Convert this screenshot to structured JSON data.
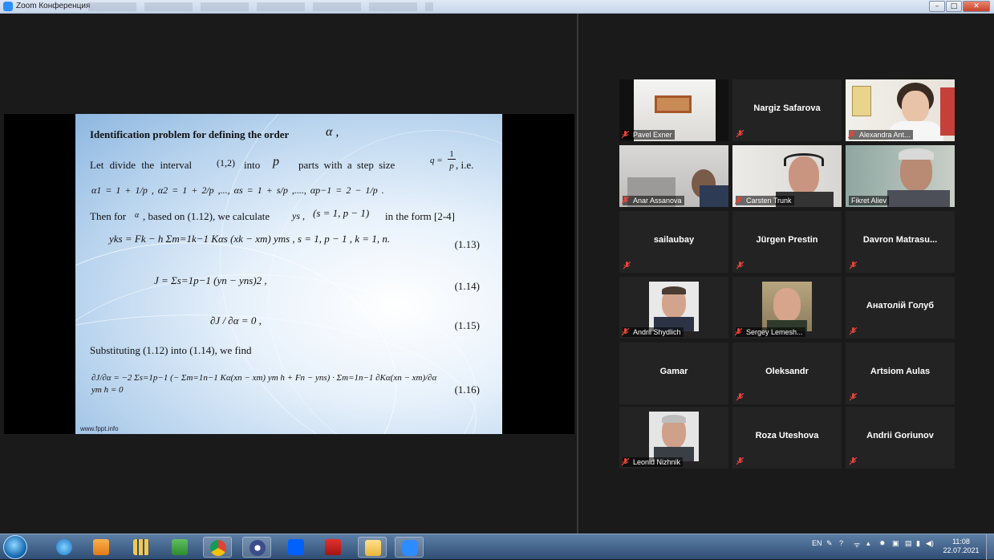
{
  "window": {
    "title": "Zoom Конференция"
  },
  "slide": {
    "heading": "Identification problem for defining the order",
    "heading_symbol": "α ,",
    "line1_prefix": "Let divide the interval",
    "interval": "(1,2)",
    "line1_mid": "into",
    "p": "p",
    "line1_suffix": "parts with a step size",
    "q_eq": "q =",
    "q_num": "1",
    "q_den": "p",
    "ie": ", i.e.",
    "alpha_line": "α1 = 1 + 1/p , α2 = 1 + 2/p ,..., αs = 1 + s/p ,...., αp−1 = 2 − 1/p .",
    "then_prefix": "Then for",
    "then_alpha": "α",
    "then_mid": ", based on (1.12), we calculate",
    "then_y": "ys ,",
    "then_range": "(s = 1, p − 1)",
    "then_suffix": "in the form  [2-4]",
    "eq113": "yks = Fk − h Σm=1k−1 Kαs (xk − xm) yms ,   s = 1, p − 1 ,   k = 1, n.",
    "eq113_no": "(1.13)",
    "eq114": "J = Σs=1p−1 (yn − yns)2 ,",
    "eq114_no": "(1.14)",
    "eq115": "∂J / ∂α = 0 ,",
    "eq115_no": "(1.15)",
    "subst": "Substituting (1.12) into (1.14), we find",
    "eq116": "∂J/∂α = −2 Σs=1p−1 (− Σm=1n−1 Kα(xn − xm) ym h + Fn − yns) · Σm=1n−1 ∂Kα(xn − xm)/∂α ym h = 0",
    "eq116_no": "(1.16)",
    "footer": "www.fppt.info"
  },
  "participants": [
    {
      "name": "Pavel Exner",
      "video": true,
      "muted": true
    },
    {
      "name": "Nargiz Safarova",
      "video": false,
      "muted": true
    },
    {
      "name": "Alexandra Ant...",
      "video": true,
      "muted": true
    },
    {
      "name": "Anar Assanova",
      "video": true,
      "muted": true
    },
    {
      "name": "Carsten Trunk",
      "video": true,
      "muted": true
    },
    {
      "name": "Fikret Aliev",
      "video": true,
      "muted": false,
      "active": true
    },
    {
      "name": "sailaubay",
      "video": false,
      "muted": true
    },
    {
      "name": "Jürgen Prestin",
      "video": false,
      "muted": true
    },
    {
      "name": "Davron  Matrasu...",
      "video": false,
      "muted": true
    },
    {
      "name": "Andrii Shydlich",
      "video": true,
      "muted": true
    },
    {
      "name": "Sergey Lemesh...",
      "video": true,
      "muted": true
    },
    {
      "name": "Анатолій Голуб",
      "video": false,
      "muted": true
    },
    {
      "name": "Gamar",
      "video": false,
      "muted": false
    },
    {
      "name": "Oleksandr",
      "video": false,
      "muted": true
    },
    {
      "name": "Artsiom Aulas",
      "video": false,
      "muted": true
    },
    {
      "name": "Leonid Nizhnik",
      "video": true,
      "muted": true
    },
    {
      "name": "Roza Uteshova",
      "video": false,
      "muted": true
    },
    {
      "name": "Andrii Goriunov",
      "video": false,
      "muted": true
    }
  ],
  "taskbar": {
    "lang": "EN",
    "time": "11:08",
    "date": "22.07.2021"
  },
  "colors": {
    "active_speaker": "#e0e06a",
    "muted_icon": "#e8433a",
    "zoom_blue": "#2d8cff"
  }
}
